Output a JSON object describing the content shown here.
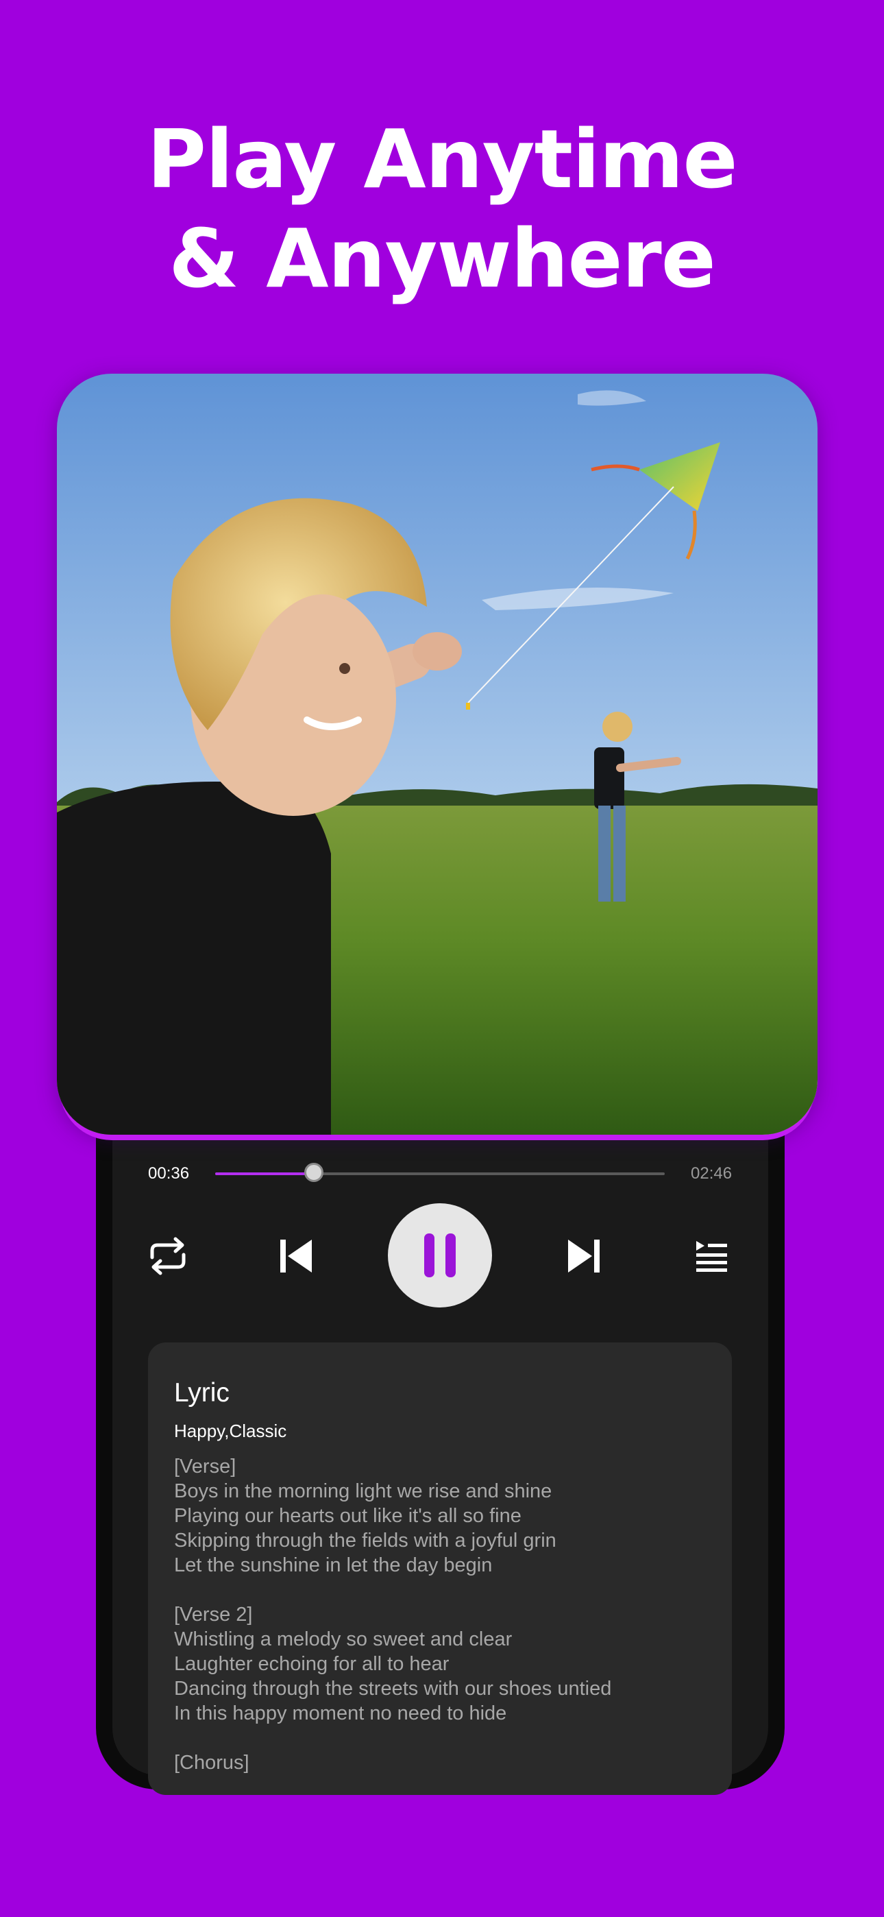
{
  "headline": {
    "line1": "Play Anytime",
    "line2": "& Anywhere"
  },
  "colors": {
    "background": "#a000de",
    "accent": "#b32ef0",
    "player_bg": "#1a1a1a",
    "card_bg": "#2a2a2a"
  },
  "artwork": {
    "description_icon": "album-artwork-photo"
  },
  "player": {
    "elapsed": "00:36",
    "duration": "02:46",
    "progress_fraction": 0.22,
    "controls": {
      "repeat_icon": "repeat-icon",
      "previous_icon": "skip-previous-icon",
      "play_state_icon": "pause-icon",
      "next_icon": "skip-next-icon",
      "queue_icon": "playlist-queue-icon"
    }
  },
  "lyrics": {
    "title": "Lyric",
    "tags": "Happy,Classic",
    "lines": [
      "[Verse]",
      "Boys in the morning light we rise and shine",
      "Playing our hearts out like it's all so fine",
      "Skipping through the fields with a joyful grin",
      "Let the sunshine in let the day begin",
      "",
      "[Verse 2]",
      "Whistling a melody so sweet and clear",
      "Laughter echoing for all to hear",
      "Dancing through the streets with our shoes untied",
      "In this happy moment no need to hide",
      "",
      "[Chorus]"
    ]
  }
}
